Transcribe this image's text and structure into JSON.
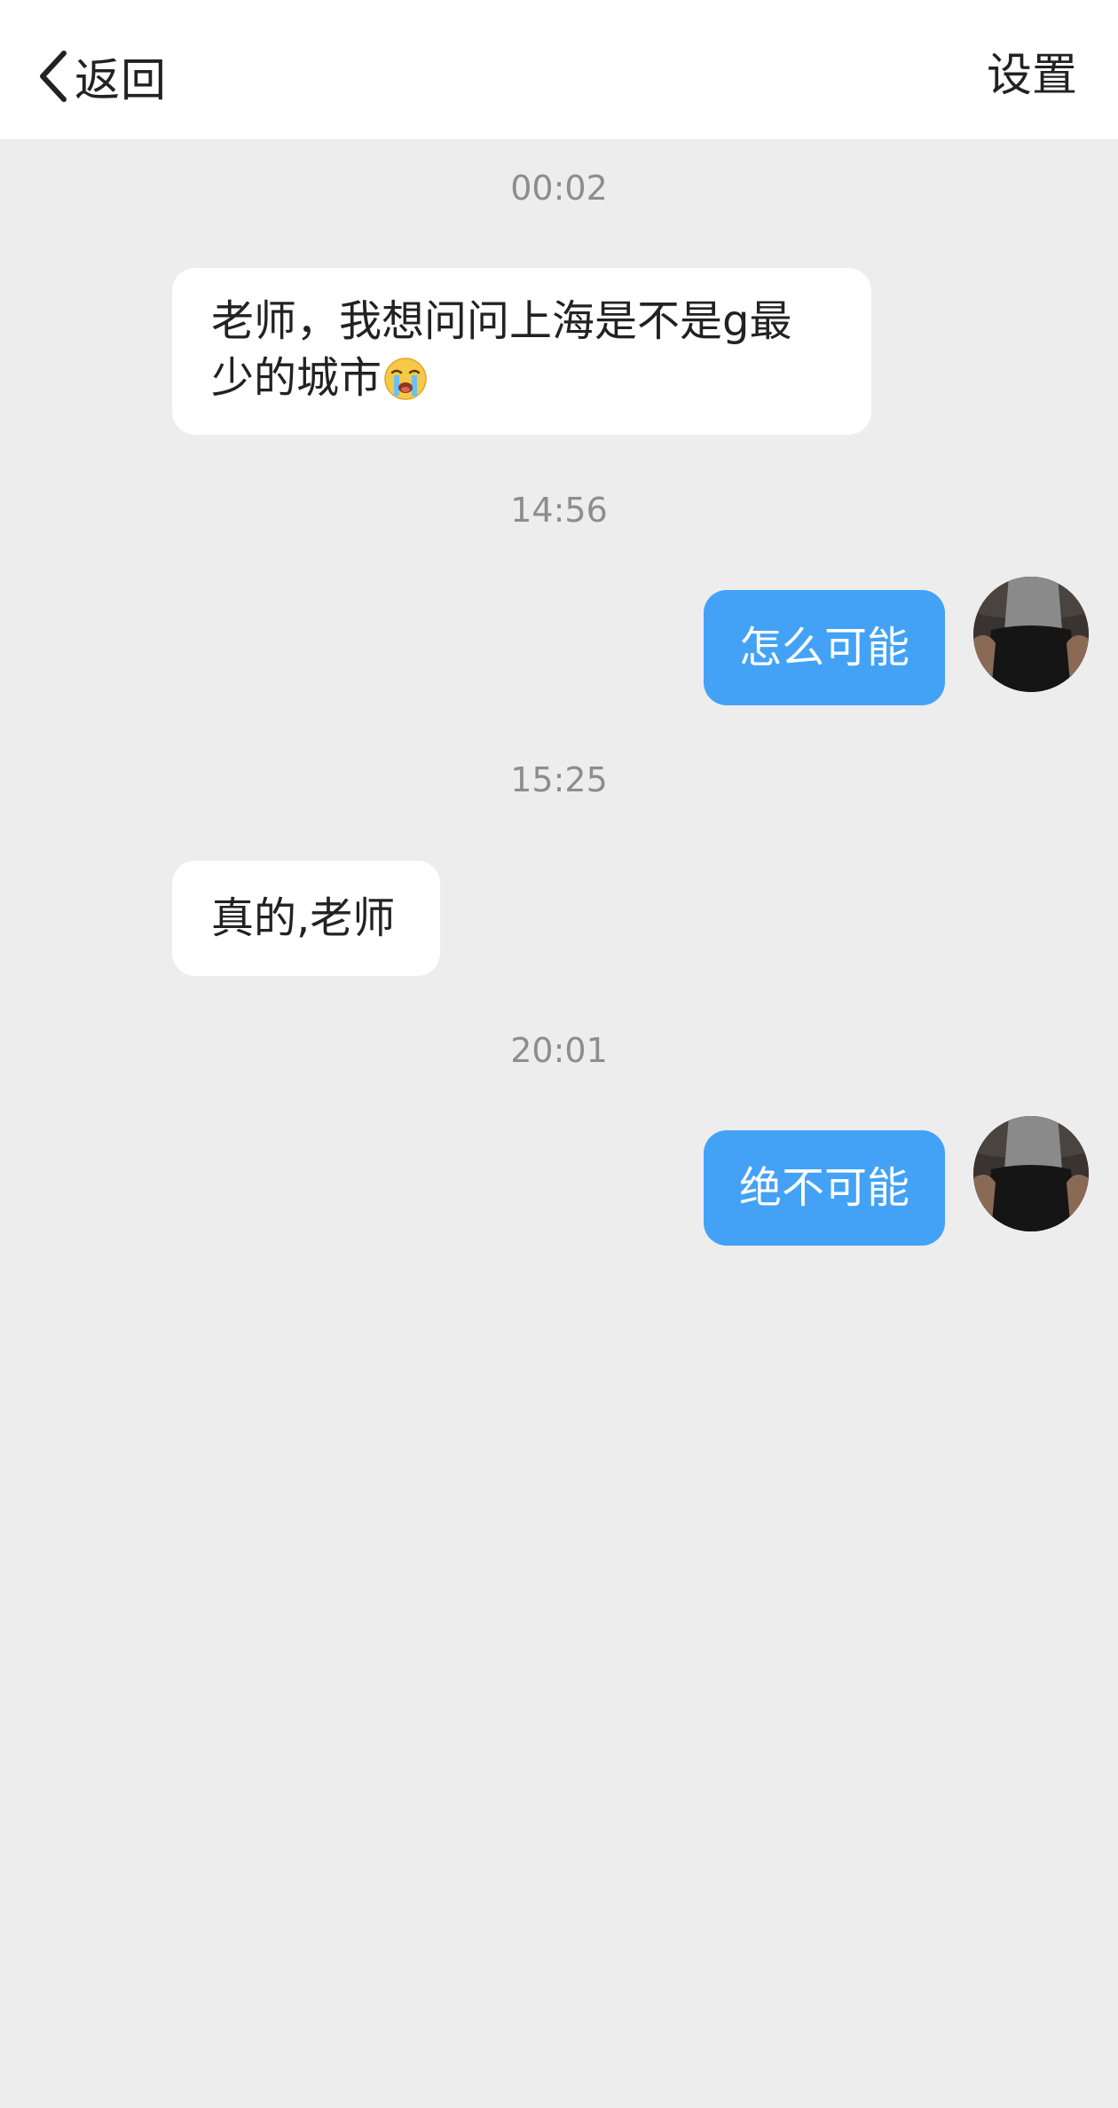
{
  "header": {
    "back_label": "返回",
    "settings_label": "设置"
  },
  "messages": [
    {
      "time": "00:02",
      "direction": "incoming",
      "text": "老师，我想问问上海是不是g最少的城市",
      "emoji": "loudly-crying-face"
    },
    {
      "time": "14:56",
      "direction": "outgoing",
      "text": "怎么可能"
    },
    {
      "time": "15:25",
      "direction": "incoming",
      "text": "真的,老师"
    },
    {
      "time": "20:01",
      "direction": "outgoing",
      "text": "绝不可能"
    }
  ],
  "colors": {
    "background": "#ededed",
    "header": "#ffffff",
    "outgoing_bubble": "#43a2f6",
    "incoming_bubble": "#ffffff",
    "timestamp": "#8d8d8d"
  },
  "icons": {
    "back": "chevron-left-icon",
    "emoji": "loudly-crying-face-icon"
  }
}
